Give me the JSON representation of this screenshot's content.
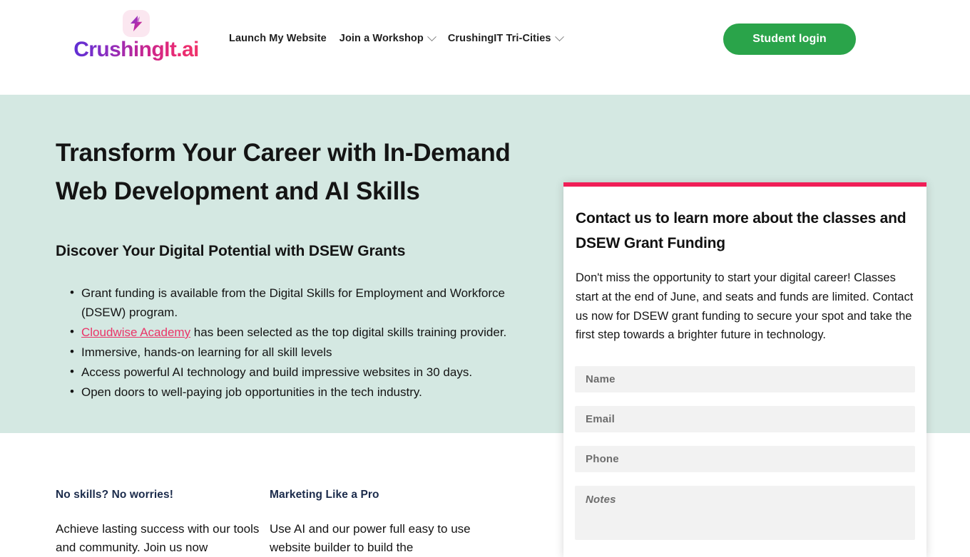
{
  "header": {
    "brand": {
      "name": "CrushingIt.ai",
      "mark_icon": "lightning-bolt-icon"
    },
    "nav": [
      {
        "label": "Launch My Website",
        "has_chevron": false
      },
      {
        "label": "Join a Workshop",
        "has_chevron": true
      },
      {
        "label": "CrushingIT Tri-Cities",
        "has_chevron": true
      }
    ],
    "login_button": "Student login",
    "login_button_color": "#2aa44a"
  },
  "hero": {
    "background_color": "#d4e8e2",
    "heading": "Transform Your Career with In-Demand Web Development and AI Skills",
    "subheading": "Discover Your Digital Potential with DSEW Grants",
    "bullets": [
      {
        "prefix": "",
        "link": "",
        "text": "Grant funding is available from the Digital Skills for Employment and Workforce (DSEW) program."
      },
      {
        "prefix": "",
        "link": "Cloudwise Academy",
        "text": " has been selected as the top digital skills training provider."
      },
      {
        "prefix": "",
        "link": "",
        "text": "Immersive, hands-on learning for all skill levels"
      },
      {
        "prefix": "",
        "link": "",
        "text": "Access powerful AI technology and build impressive websites in 30 days."
      },
      {
        "prefix": "",
        "link": "",
        "text": "Open doors to well-paying job opportunities in the tech industry."
      }
    ],
    "link_color": "#ea3468"
  },
  "contact_card": {
    "accent_color": "#f01e57",
    "title": "Contact us to learn more about the classes and DSEW Grant Funding",
    "body": "Don't miss the opportunity to start your digital career! Classes start at the end of June, and seats and funds are limited. Contact us now for DSEW grant funding to secure your spot and take the first step towards a brighter future in technology.",
    "fields": {
      "name_placeholder": "Name",
      "name_value": "",
      "email_placeholder": "Email",
      "email_value": "",
      "phone_placeholder": "Phone",
      "phone_value": "",
      "notes_placeholder": "Notes",
      "notes_value": ""
    }
  },
  "features": [
    {
      "heading": "No skills? No worries!",
      "text": "Achieve lasting success with our tools and community. Join us now"
    },
    {
      "heading": "Marketing Like a Pro",
      "text": "Use AI and our power full easy to use website builder to build the"
    }
  ]
}
